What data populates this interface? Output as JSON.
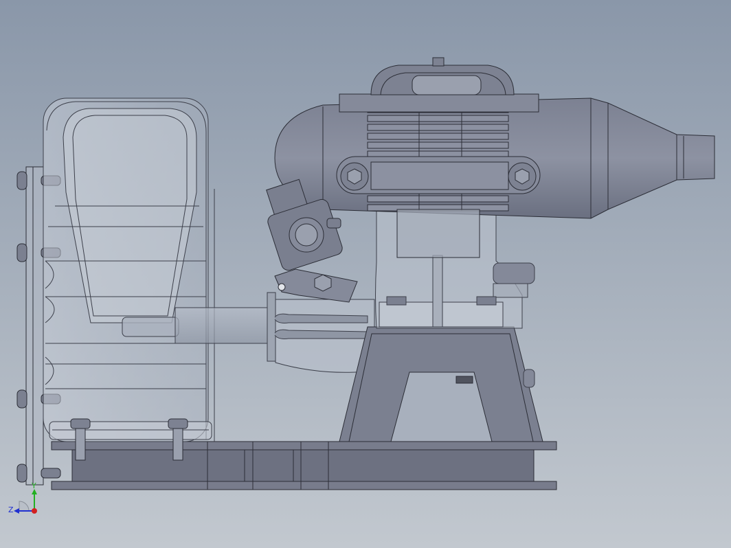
{
  "viewport": {
    "view": "cad-3d-viewport",
    "background_top": "#8a97a9",
    "background_bottom": "#c2c8cf"
  },
  "model": {
    "description_icon": "engine-assembly",
    "body_color": "#777c8c",
    "edge_color": "#2b2d36",
    "transparent_color": "#b8c0cc"
  },
  "triad": {
    "y_label": "Y",
    "z_label": "Z",
    "x_color": "#d22020",
    "y_color": "#22b022",
    "z_color": "#2030d0"
  }
}
